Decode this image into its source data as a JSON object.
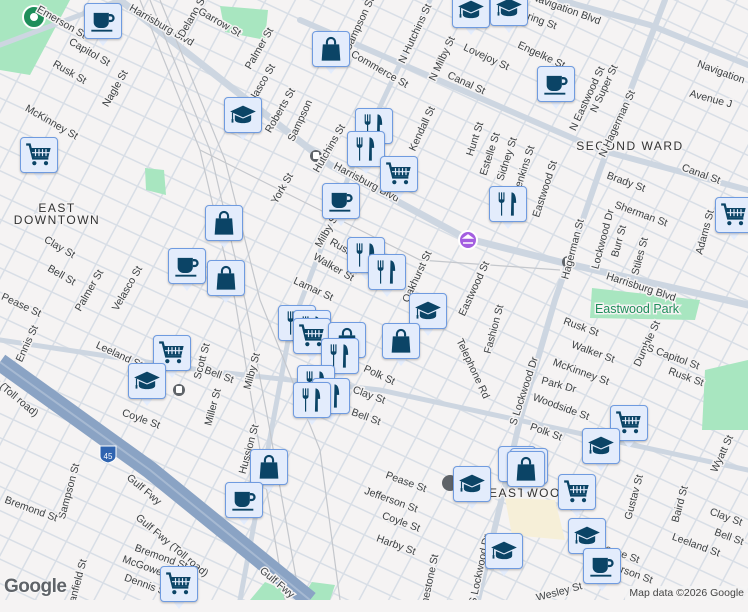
{
  "map": {
    "area_labels": [
      "EAST",
      "DOWNTOWN",
      "SECOND WARD",
      "EASTWOOD"
    ],
    "park_labels": [
      "Eastwood Park"
    ],
    "highway_shield": "45",
    "streets": [
      "Harrisburg Blvd",
      "Delano St",
      "Garrow St",
      "Palmer St",
      "Velasco St",
      "Roberts St",
      "Sampson",
      "N Sampson St",
      "Commerce St",
      "Capitol St",
      "Rusk St",
      "Nagle St",
      "McKinney St",
      "Hutchins St",
      "York St",
      "Harrisburg Blvd",
      "Milby St",
      "Rusk St",
      "Walker St",
      "Lamar St",
      "Clay St",
      "Bell St",
      "Palmer St",
      "Velasco St",
      "N Hutchins St",
      "N Milby St",
      "Lovejoy St",
      "Engelke St",
      "Bering St",
      "Navigation Blvd",
      "Canal St",
      "Kendall St",
      "Hunt St",
      "Estelle St",
      "Sidney St",
      "Jenkins St",
      "Eastwood St",
      "N Eastwood St",
      "N Super St",
      "N Hagerman St",
      "Canal St",
      "Navigation",
      "Avenue J",
      "Brady St",
      "Sherman St",
      "Lockwood Dr",
      "Hagerman St",
      "Burr St",
      "Stiles St",
      "Adams St",
      "Harrisburg Blvd",
      "Oakhurst St",
      "Eastwood St",
      "Fashion St",
      "Telephone Rd",
      "Rusk St",
      "Walker St",
      "McKinney St",
      "Park Dr",
      "Woodside St",
      "S Lockwood Dr",
      "Polk St",
      "Polk St",
      "Dumble St",
      "S Capitol St",
      "Rusk St",
      "Wyatt St",
      "Pease St",
      "Jefferson St",
      "Coyle St",
      "Harby St",
      "Clay St",
      "Bell St",
      "Leeland St",
      "Gustav St",
      "Baird St",
      "Pease St",
      "Jefferson St",
      "Wesley St",
      "Leeland St",
      "Ennis St",
      "Pease St",
      "Bell St",
      "Scott St",
      "Milby St",
      "Miller St",
      "Hussion St",
      "Coyle St",
      "Gulf Fwy (Toll road)",
      "Gulf Fwy",
      "Gulf Fwy",
      "Sampson St",
      "Bremond St",
      "Canfield St",
      "Bremond St",
      "McGowen St",
      "Dennis St",
      "Clay St",
      "Bell St",
      "Limestone St",
      "S Lockwood Dr",
      "Gulf Fwy (Toll road)",
      "Emerson St"
    ],
    "markers": [
      "coffee",
      "shopping",
      "coffee",
      "education",
      "grocery",
      "restaurant",
      "restaurant",
      "grocery",
      "coffee",
      "restaurant",
      "shopping",
      "restaurant",
      "restaurant",
      "coffee",
      "shopping",
      "education",
      "shopping",
      "restaurant",
      "restaurant",
      "grocery",
      "shopping",
      "restaurant",
      "grocery",
      "education",
      "restaurant",
      "restaurant",
      "restaurant",
      "shopping",
      "coffee",
      "grocery",
      "education",
      "restaurant",
      "grocery",
      "shopping",
      "grocery",
      "education",
      "grocery",
      "education",
      "coffee",
      "education",
      "grocery",
      "education",
      "education"
    ],
    "colors": {
      "marker_bg": "#e3ecfc",
      "marker_border": "#6f9be0",
      "icon": "#0b4466",
      "park": "#a8e6c0",
      "freeway": "#8aa3c4",
      "road": "#d3dbe5"
    }
  },
  "footer": {
    "logo": "Google",
    "attribution": "Map data ©2026 Google"
  }
}
